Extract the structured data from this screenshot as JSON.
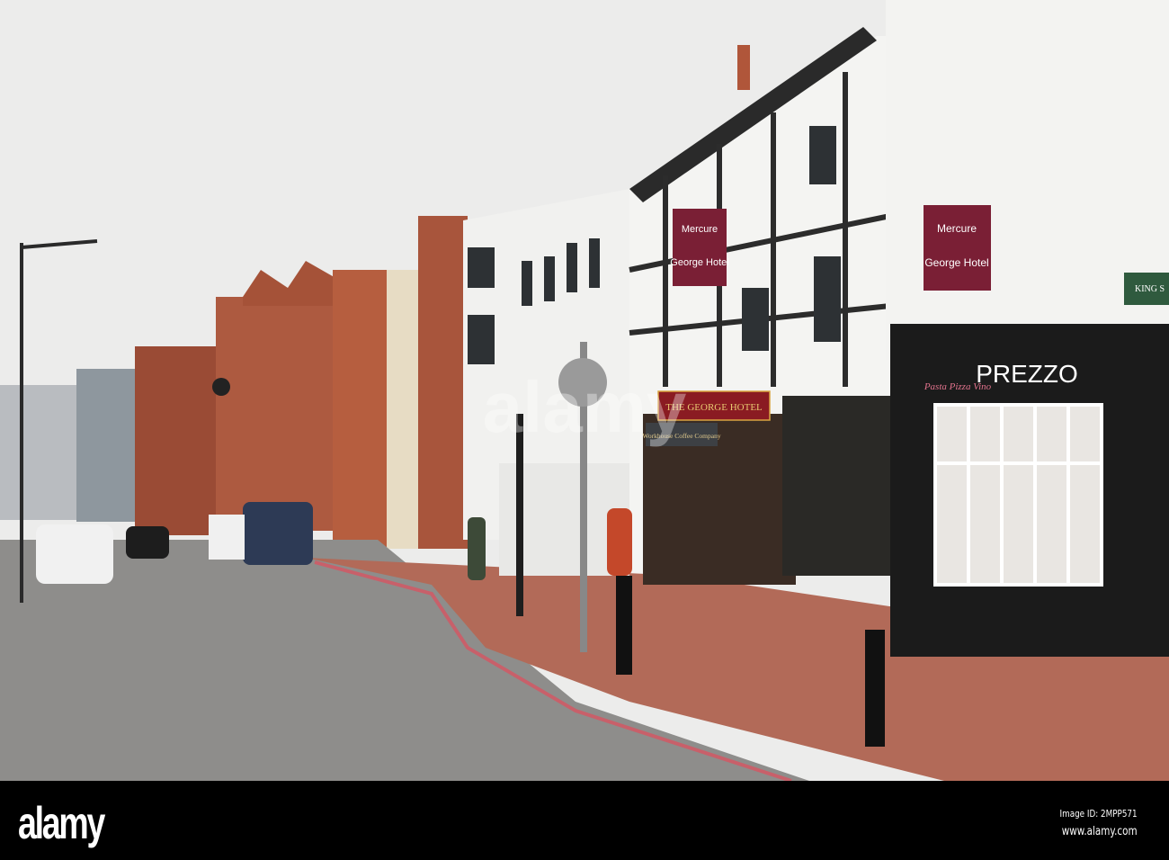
{
  "photo": {
    "signs": {
      "mercure_brand": "Mercure",
      "mercure_hotel_name": "George Hotel",
      "fascia_hotel": "THE GEORGE HOTEL",
      "coffee_shop": "Workhouse Coffee Company",
      "prezzo_tagline": "Pasta Pizza Vino",
      "prezzo_name": "PREZZO",
      "street_sign": "KING S"
    },
    "watermark": "alamy"
  },
  "footer": {
    "logo": "alamy",
    "image_id": "Image ID: 2MPP571",
    "url": "www.alamy.com"
  },
  "colors": {
    "sky": "#ececeb",
    "brick": "#a5523a",
    "pavement": "#b26a58",
    "road": "#8e8d8b",
    "sign_maroon": "#7a1f35",
    "shopfront": "#1b1b1b"
  }
}
